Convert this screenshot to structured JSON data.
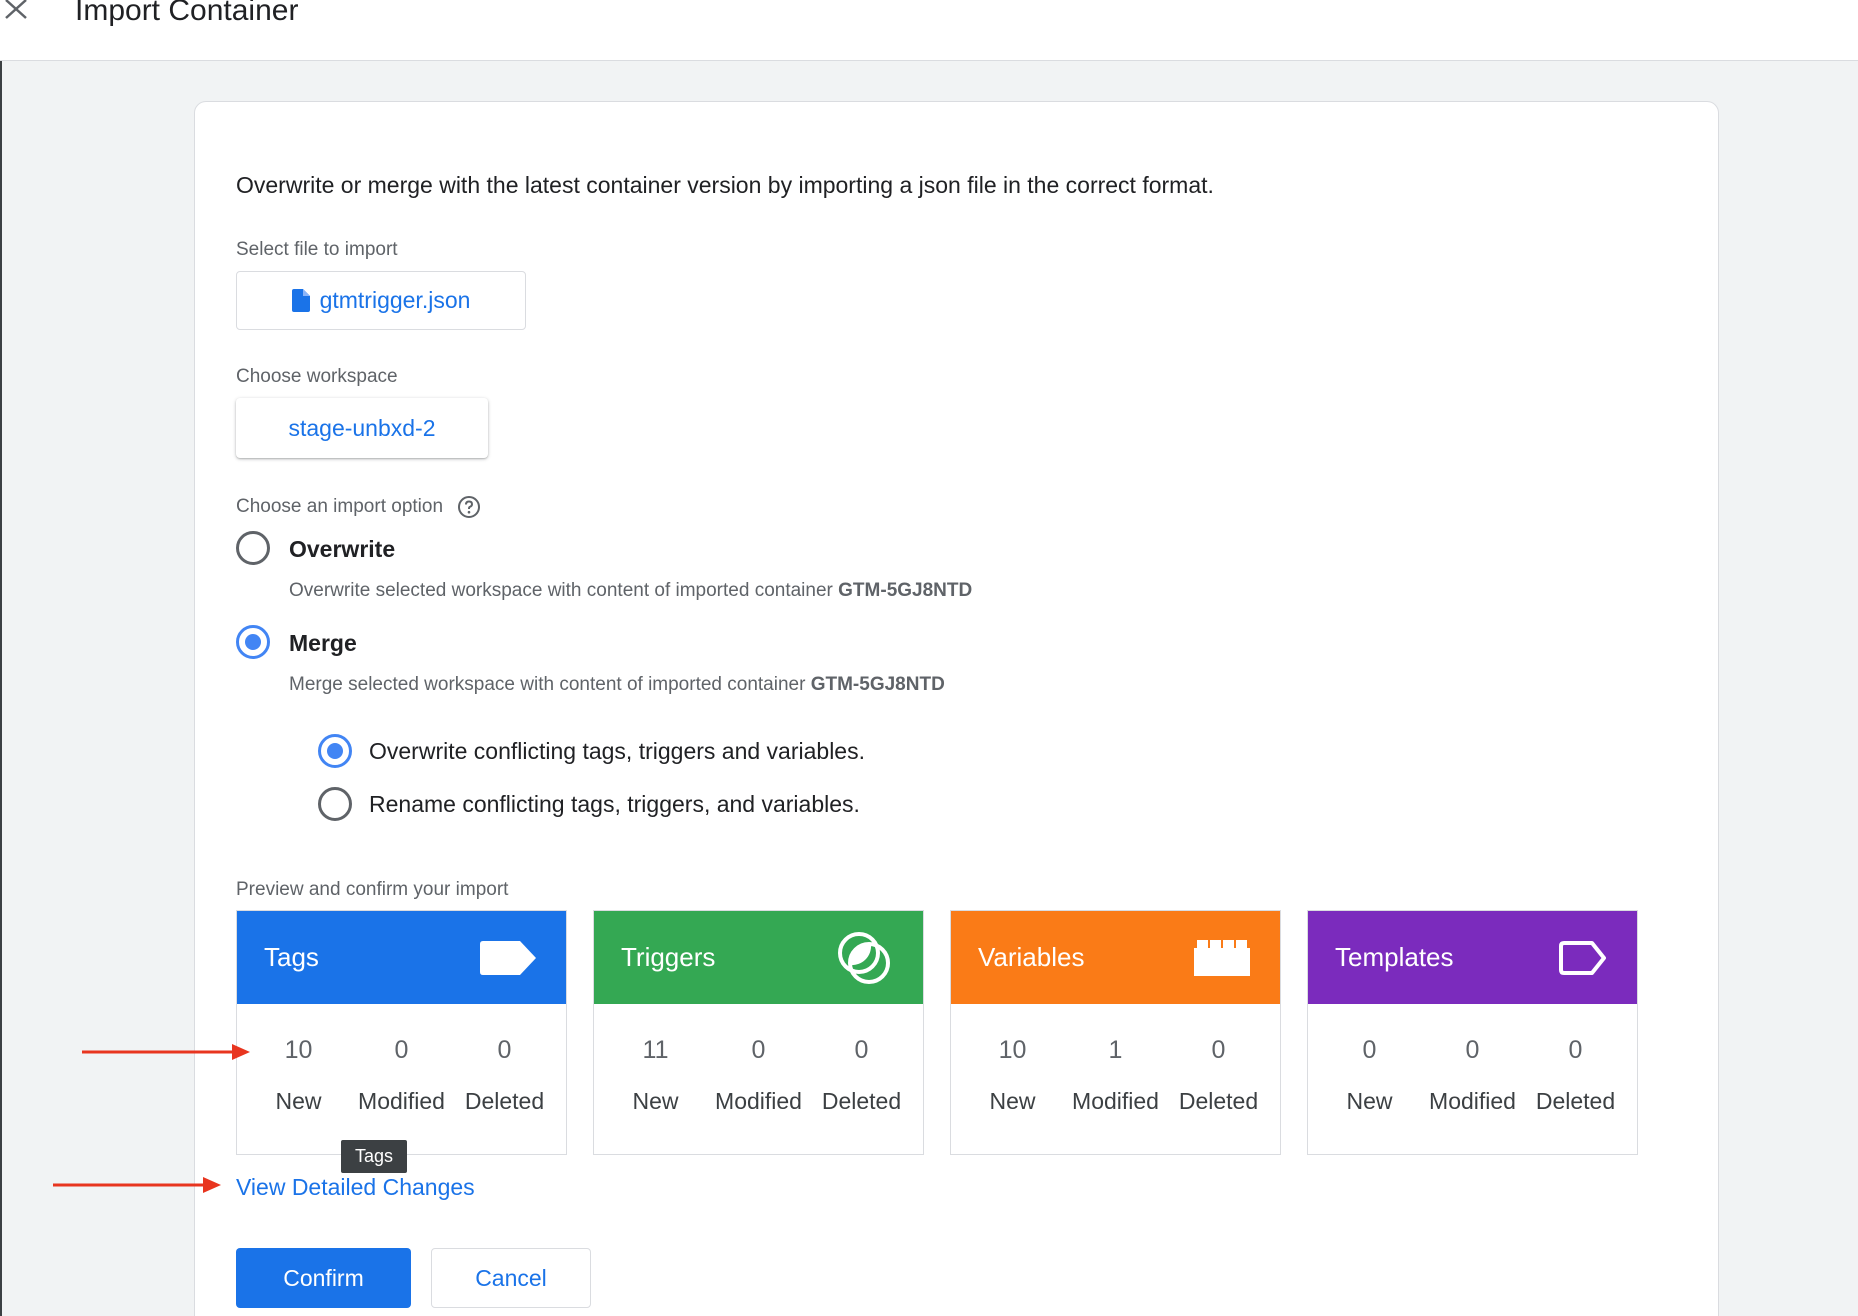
{
  "header": {
    "title": "Import Container",
    "close_icon": "close-icon"
  },
  "intro": "Overwrite or merge with the latest container version by importing a json file in the correct format.",
  "file": {
    "label": "Select file to import",
    "filename": "gtmtrigger.json",
    "icon": "file-icon"
  },
  "workspace": {
    "label": "Choose workspace",
    "value": "stage-unbxd-2"
  },
  "import_option": {
    "label": "Choose an import option",
    "help_icon": "help-icon",
    "options": [
      {
        "title": "Overwrite",
        "desc": "Overwrite selected workspace with content of imported container ",
        "container": "GTM-5GJ8NTD",
        "selected": false
      },
      {
        "title": "Merge",
        "desc": "Merge selected workspace with content of imported container ",
        "container": "GTM-5GJ8NTD",
        "selected": true
      }
    ],
    "merge_options": [
      {
        "label": "Overwrite conflicting tags, triggers and variables.",
        "selected": true
      },
      {
        "label": "Rename conflicting tags, triggers, and variables.",
        "selected": false
      }
    ]
  },
  "preview": {
    "label": "Preview and confirm your import",
    "stat_labels": [
      "New",
      "Modified",
      "Deleted"
    ],
    "tiles": [
      {
        "title": "Tags",
        "color": "#1a73e8",
        "icon": "tag-icon",
        "new": "10",
        "modified": "0",
        "deleted": "0"
      },
      {
        "title": "Triggers",
        "color": "#34a853",
        "icon": "trigger-icon",
        "new": "11",
        "modified": "0",
        "deleted": "0"
      },
      {
        "title": "Variables",
        "color": "#fa7b17",
        "icon": "variable-icon",
        "new": "10",
        "modified": "1",
        "deleted": "0"
      },
      {
        "title": "Templates",
        "color": "#7b2bbd",
        "icon": "template-icon",
        "new": "0",
        "modified": "0",
        "deleted": "0"
      }
    ]
  },
  "tooltip": "Tags",
  "view_link": "View Detailed Changes",
  "buttons": {
    "confirm": "Confirm",
    "cancel": "Cancel"
  },
  "annotation_color": "#e8351f"
}
